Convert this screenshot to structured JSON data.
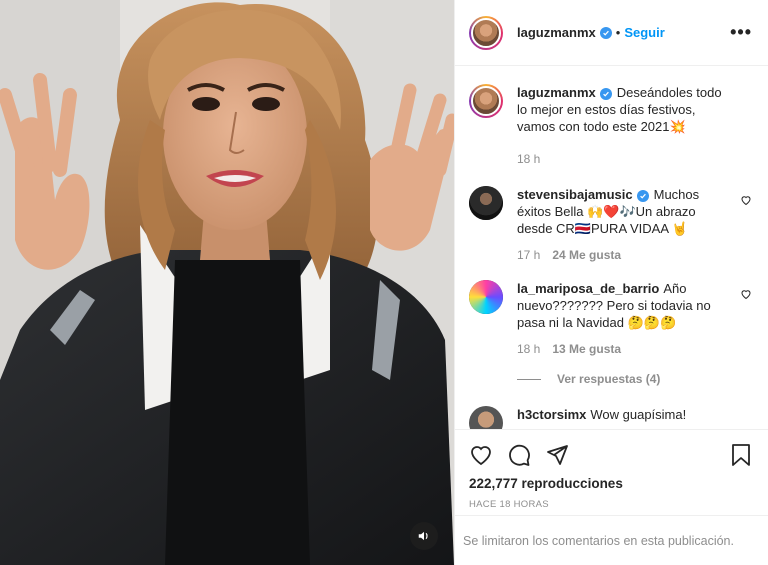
{
  "post": {
    "username": "laguzmanmx",
    "dot": "•",
    "follow_label": "Seguir",
    "more_label": "•••"
  },
  "caption": {
    "username": "laguzmanmx",
    "text": "Deseándoles todo lo mejor en estos días festivos, vamos con todo este 2021💥",
    "time": "18 h"
  },
  "comments": [
    {
      "username": "stevensibajamusic",
      "verified": true,
      "text": "Muchos éxitos Bella 🙌❤️🎶Un abrazo desde CR🇨🇷PURA VIDAA 🤘",
      "time": "17 h",
      "likes": "24 Me gusta"
    },
    {
      "username": "la_mariposa_de_barrio",
      "verified": false,
      "text": "Año nuevo??????? Pero si todavia no pasa ni la Navidad 🤔🤔🤔",
      "time": "18 h",
      "likes": "13 Me gusta",
      "replies_label": "Ver respuestas (4)"
    },
    {
      "username": "h3ctorsimx",
      "verified": false,
      "text": "Wow guapísima!"
    }
  ],
  "stats": {
    "views": "222,777 reproducciones",
    "posted_ago": "HACE 18 HORAS"
  },
  "footer": {
    "comments_limited": "Se limitaron los comentarios en esta publicación."
  },
  "colors": {
    "accent": "#0095f6",
    "verified": "#3897f0",
    "muted": "#8e8e8e",
    "text": "#262626"
  },
  "icons": [
    "volume-icon",
    "verified-icon",
    "heart-icon",
    "comment-icon",
    "share-icon",
    "bookmark-icon",
    "more-icon"
  ]
}
